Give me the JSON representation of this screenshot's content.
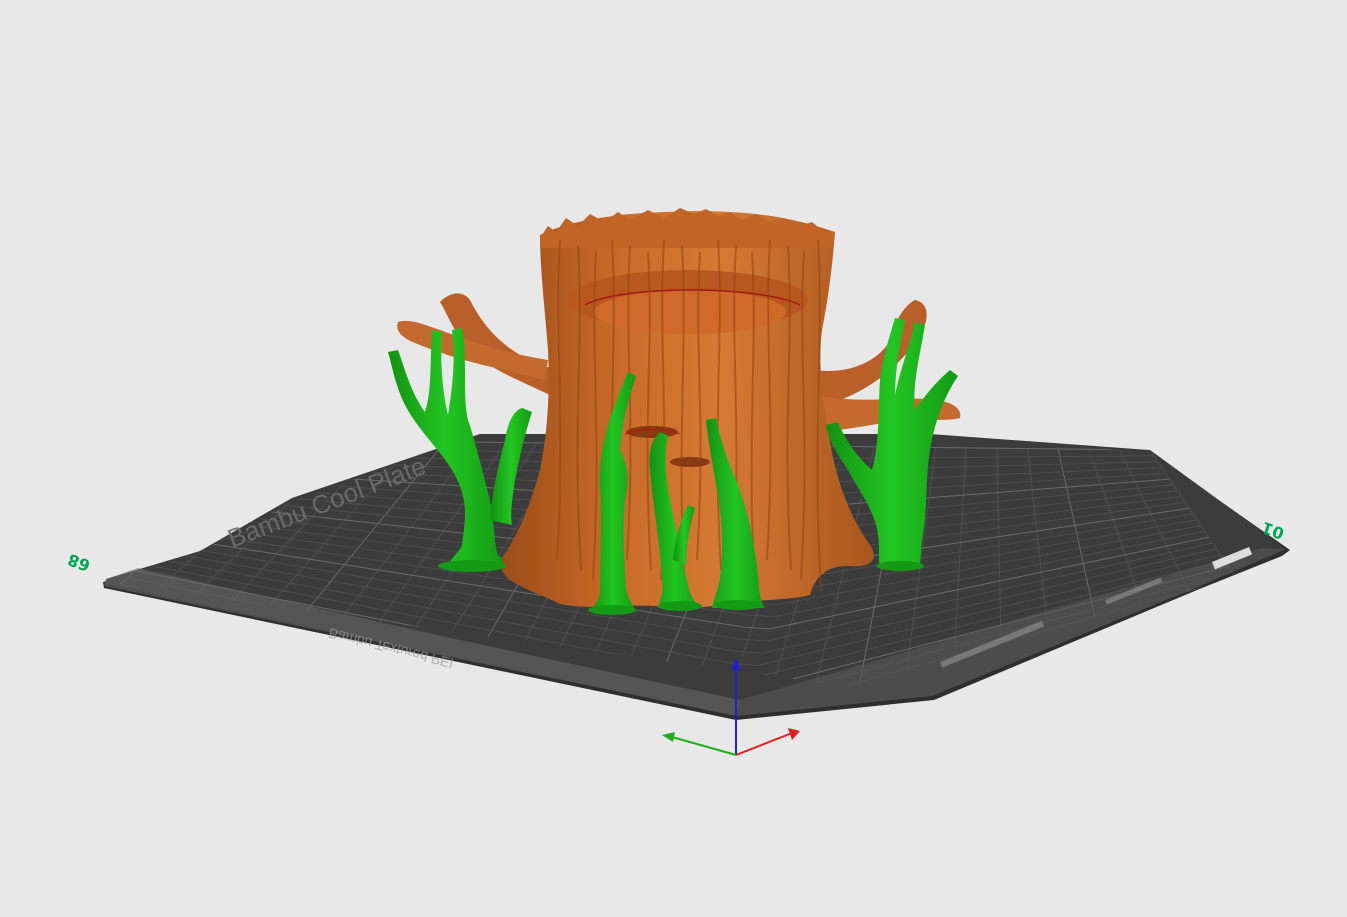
{
  "plate": {
    "number_left": "68",
    "number_right": "01",
    "brand_text": "Bambu Cool Plate",
    "front_text": "Bambu Textured PEI",
    "grid": true
  },
  "colors": {
    "background": "#e8e8e8",
    "plate": "#3c3c3c",
    "plate_edge": "#2a2a2a",
    "grid_line": "#5a5a5a",
    "plate_number": "#00a651",
    "model_main": "#c86a28",
    "model_dark": "#8f4414",
    "model_highlight": "#e08a48",
    "support": "#1fbf1f",
    "support_dark": "#139113",
    "axis_x": "#e02020",
    "axis_y": "#1faf1f",
    "axis_z": "#2020d0"
  },
  "objects": [
    {
      "name": "tree-stump-planter",
      "role": "model"
    },
    {
      "name": "tree-supports",
      "role": "support"
    }
  ]
}
